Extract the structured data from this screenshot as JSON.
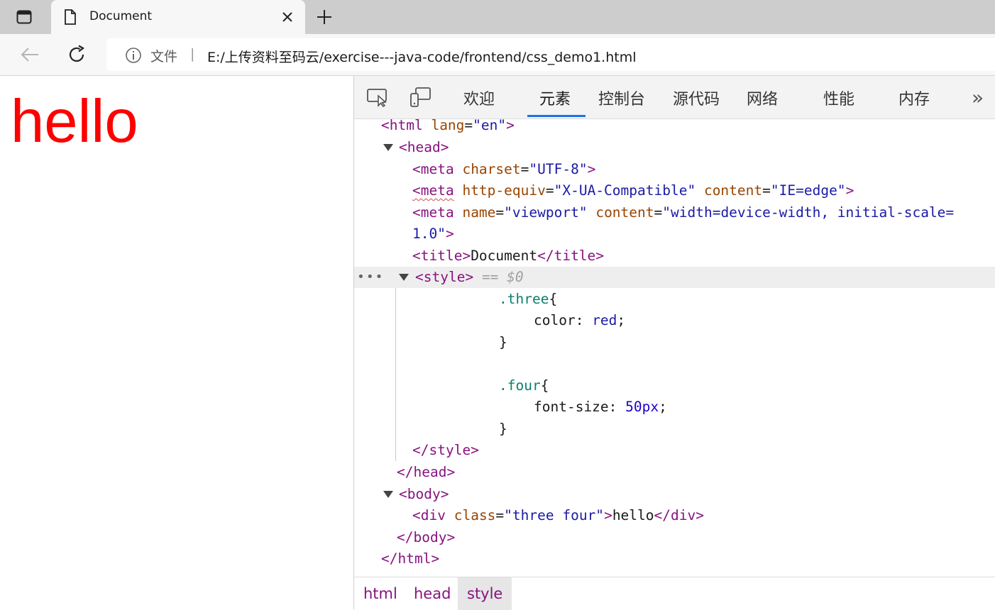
{
  "browser": {
    "tab_title": "Document",
    "address": {
      "file_label": "文件",
      "separator": "|",
      "url": "E:/上传资料至码云/exercise---java-code/frontend/css_demo1.html"
    }
  },
  "page": {
    "content_text": "hello",
    "content_color": "#ff0000"
  },
  "devtools": {
    "tabs": [
      {
        "label": "欢迎"
      },
      {
        "label": "元素",
        "active": true
      },
      {
        "label": "控制台"
      },
      {
        "label": "源代码"
      },
      {
        "label": "网络"
      },
      {
        "label": "性能"
      },
      {
        "label": "内存"
      }
    ],
    "dom": {
      "html_open": {
        "tag": "<html",
        "attr": "lang",
        "eq": "=",
        "q1": "\"",
        "val": "en",
        "q2": "\"",
        "close": ">"
      },
      "head_open": "<head>",
      "meta1": {
        "open": "<meta",
        "attr": "charset",
        "val": "\"UTF-8\"",
        "close": ">"
      },
      "meta2": {
        "open": "<meta",
        "attr1": "http-equiv",
        "val1": "\"X-UA-Compatible\"",
        "attr2": "content",
        "val2": "\"IE=edge\"",
        "close": ">"
      },
      "meta3": {
        "open": "<meta",
        "attr1": "name",
        "val1": "\"viewport\"",
        "attr2": "content",
        "val2a": "\"width=device-width, initial-scale=",
        "val2b": "1.0\"",
        "close": ">"
      },
      "title": {
        "open": "<title>",
        "text": "Document",
        "close": "</title>"
      },
      "style_open": "<style>",
      "style_marker": "== $0",
      "css": {
        "three_sel": ".three",
        "brace_open": "{",
        "color_prop": "color",
        "color_val": "red",
        "brace_close": "}",
        "four_sel": ".four",
        "size_prop": "font-size",
        "size_val": "50px"
      },
      "style_close": "</style>",
      "head_close": "</head>",
      "body_open": "<body>",
      "div": {
        "open": "<div",
        "attr": "class",
        "val": "\"three four\"",
        "gt": ">",
        "text": "hello",
        "close": "</div>"
      },
      "body_close": "</body>",
      "html_close": "</html>"
    },
    "breadcrumbs": [
      {
        "label": "html"
      },
      {
        "label": "head"
      },
      {
        "label": "style",
        "active": true
      }
    ]
  }
}
